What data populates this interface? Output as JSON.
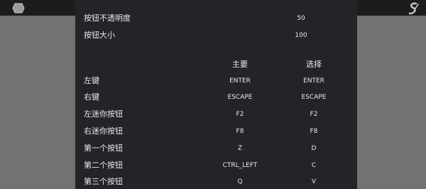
{
  "header": {
    "left_icon": "game-logo-icon",
    "right_icon": "s-logo-icon",
    "notch_icon": "pull-down-icon"
  },
  "settings": {
    "opacity_label": "按钮不透明度",
    "opacity_value": "50",
    "size_label": "按钮大小",
    "size_value": "100"
  },
  "table": {
    "col_primary": "主要",
    "col_select": "选择",
    "rows": [
      {
        "label": "左键",
        "primary": "ENTER",
        "select": "ENTER"
      },
      {
        "label": "右键",
        "primary": "ESCAPE",
        "select": "ESCAPE"
      },
      {
        "label": "左迷你按钮",
        "primary": "F2",
        "select": "F2"
      },
      {
        "label": "右迷你按钮",
        "primary": "F8",
        "select": "F8"
      },
      {
        "label": "第一个按钮",
        "primary": "Z",
        "select": "D"
      },
      {
        "label": "第二个按钮",
        "primary": "CTRL_LEFT",
        "select": "C"
      },
      {
        "label": "第三个按钮",
        "primary": "Q",
        "select": "V"
      }
    ]
  },
  "colors": {
    "panel": "#242428",
    "topbar": "#1c1c1c",
    "backdrop": "#727272"
  }
}
